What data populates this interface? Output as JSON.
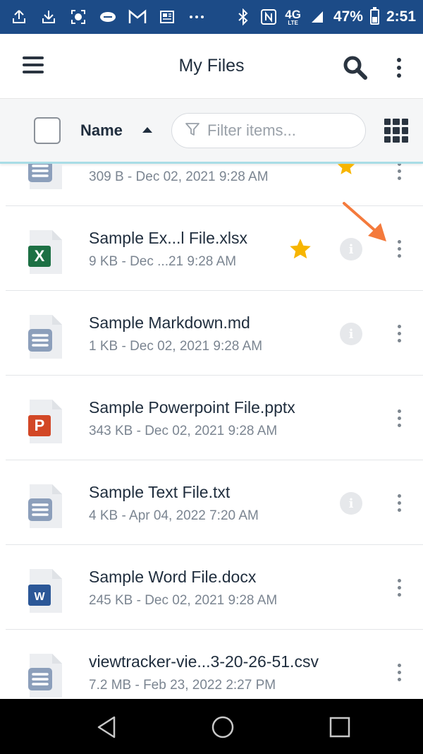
{
  "status_bar": {
    "network_label": "4G",
    "network_sub": "LTE",
    "battery_text": "47%",
    "battery_level": 0.47,
    "time": "2:51",
    "left_icons": [
      "upload-notification-icon",
      "download-notification-icon",
      "screen-record-icon",
      "nfl-icon",
      "gmail-icon",
      "news-icon",
      "more-notifications-icon"
    ]
  },
  "app_bar": {
    "title": "My Files"
  },
  "toolbar": {
    "sort_label": "Name",
    "filter_placeholder": "Filter items..."
  },
  "files": [
    {
      "name": "",
      "meta": "309 B - Dec 02, 2021 9:28 AM",
      "type": "doc",
      "starred": true,
      "info": false
    },
    {
      "name": "Sample Ex...l File.xlsx",
      "meta": "9 KB - Dec ...21 9:28 AM",
      "type": "xlsx",
      "starred": true,
      "info": true
    },
    {
      "name": "Sample Markdown.md",
      "meta": "1 KB - Dec 02, 2021 9:28 AM",
      "type": "doc",
      "starred": false,
      "info": true
    },
    {
      "name": "Sample Powerpoint File.pptx",
      "meta": "343 KB - Dec 02, 2021 9:28 AM",
      "type": "pptx",
      "starred": false,
      "info": false
    },
    {
      "name": "Sample Text File.txt",
      "meta": "4 KB - Apr 04, 2022 7:20 AM",
      "type": "doc",
      "starred": false,
      "info": true
    },
    {
      "name": "Sample Word File.docx",
      "meta": "245 KB - Dec 02, 2021 9:28 AM",
      "type": "docx",
      "starred": false,
      "info": false
    },
    {
      "name": "viewtracker-vie...3-20-26-51.csv",
      "meta": "7.2 MB - Feb 23, 2022 2:27 PM",
      "type": "doc",
      "starred": false,
      "info": false
    }
  ],
  "icon_letters": {
    "xlsx": "X",
    "pptx": "P",
    "docx": "W"
  },
  "colors": {
    "status_bar": "#1c4b87",
    "accent_line": "#a9dde6",
    "star": "#f7b500",
    "xlsx": "#1d7044",
    "pptx": "#d24726",
    "docx": "#2b5797",
    "generic_doc": "#8c9fbb",
    "annotation_arrow": "#f47a3c"
  }
}
